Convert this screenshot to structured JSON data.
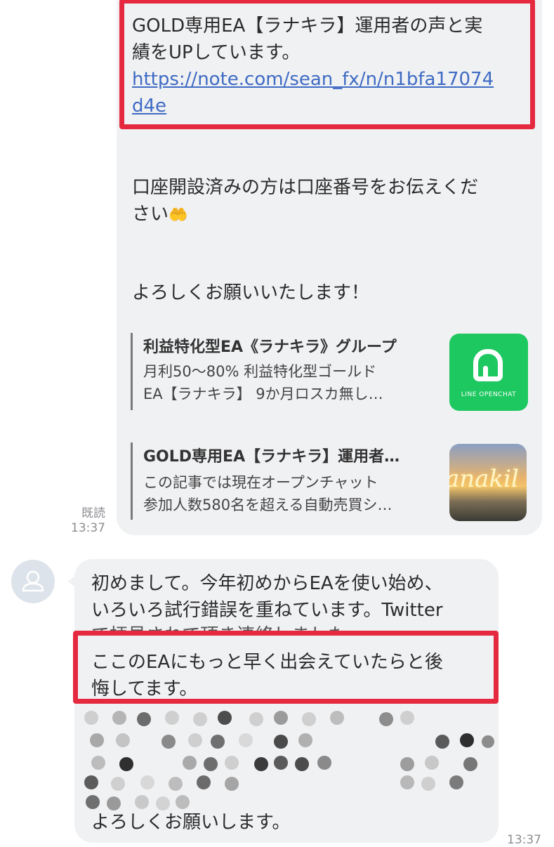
{
  "sent_message": {
    "intro_line1": "GOLD専用EA【ラナキラ】運用者の声と実",
    "intro_line2": "績をUPしています。",
    "link_line1": "https://note.com/sean_fx/n/n1bfa17074",
    "link_line2": "d4e",
    "account_line1": "口座開設済みの方は口座番号をお伝えくだ",
    "account_line2": "さい",
    "account_emoji": "🤲",
    "closing": "よろしくお願いいたします！",
    "read_status": "既読",
    "time": "13:37"
  },
  "previews": [
    {
      "title": "利益特化型EA《ラナキラ》グループ",
      "desc_line1": "月利50〜80% 利益特化型ゴールド",
      "desc_line2": "EA【ラナキラ】 9か月ロスカ無し…",
      "thumb_label": "LINE OPENCHAT"
    },
    {
      "title": "GOLD専用EA【ラナキラ】運用者…",
      "desc_line1": "この記事では現在オープンチャット",
      "desc_line2": "参加人数580名を超える自動売買シ…",
      "thumb_script": "anakil"
    }
  ],
  "received_message": {
    "line1": "初めまして。今年初めからEAを使い始め、",
    "line2": "いろいろ試行錯誤を重ねています。Twitter",
    "line3_partial": "で拝見されて頂き連絡しました",
    "highlight_line1": "ここのEAにもっと早く出会えていたらと後",
    "highlight_line2": "悔してます。",
    "closing": "よろしくお願いします。",
    "time": "13:37"
  },
  "colors": {
    "highlight": "#e5293e",
    "link": "#3f6bc4",
    "bubble": "#f0f1f3",
    "openchat_green": "#1ec860"
  }
}
